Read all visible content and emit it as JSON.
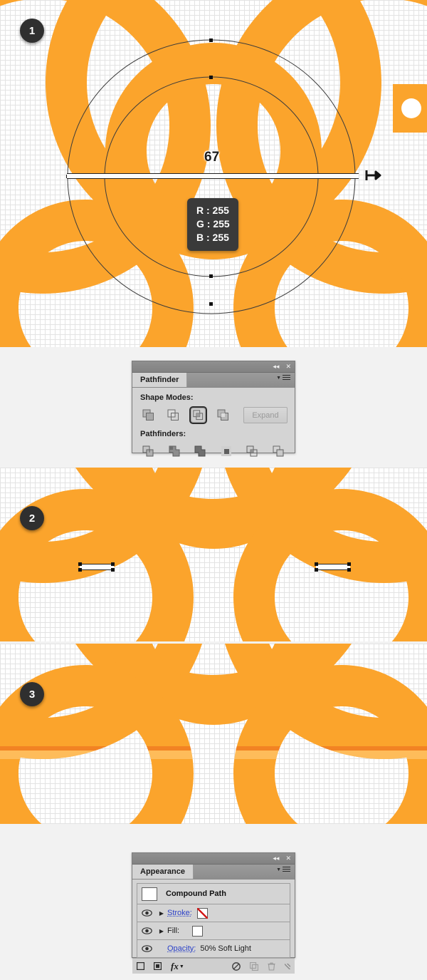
{
  "artwork": {
    "fill_color": "#fba42c",
    "highlight_color": "#f78e2a",
    "canvas_bg": "#ffffff",
    "grid_color": "#e3e3e3"
  },
  "steps": [
    {
      "number": "1",
      "name": "step-one"
    },
    {
      "number": "2",
      "name": "step-two"
    },
    {
      "number": "3",
      "name": "step-three"
    }
  ],
  "canvas1": {
    "measurement": "67",
    "rgb_tooltip": {
      "r": "R : 255",
      "g": "G : 255",
      "b": "B : 255"
    },
    "cursor": "horizontal-resize-cursor"
  },
  "pathfinder_panel": {
    "title": "Pathfinder",
    "titlebar": {
      "collapse_icon": "collapse-to-icons-icon",
      "collapse_glyph": "◂◂",
      "close_icon": "close-icon",
      "close_glyph": "✕"
    },
    "menu_icon": "panel-menu-icon",
    "shape_modes_label": "Shape Modes:",
    "shape_modes": [
      {
        "name": "unite-button",
        "label": "Unite",
        "selected": false
      },
      {
        "name": "minus-front-button",
        "label": "Minus Front",
        "selected": false
      },
      {
        "name": "intersect-button",
        "label": "Intersect",
        "selected": true
      },
      {
        "name": "exclude-button",
        "label": "Exclude",
        "selected": false
      }
    ],
    "expand_label": "Expand",
    "pathfinders_label": "Pathfinders:",
    "pathfinders": [
      {
        "name": "divide-button",
        "label": "Divide"
      },
      {
        "name": "trim-button",
        "label": "Trim"
      },
      {
        "name": "merge-button",
        "label": "Merge"
      },
      {
        "name": "crop-button",
        "label": "Crop"
      },
      {
        "name": "outline-button",
        "label": "Outline"
      },
      {
        "name": "minus-back-button",
        "label": "Minus Back"
      }
    ]
  },
  "appearance_panel": {
    "title": "Appearance",
    "titlebar": {
      "collapse_glyph": "◂◂",
      "close_glyph": "✕"
    },
    "object_label": "Compound Path",
    "rows": [
      {
        "name": "appearance-row-stroke",
        "label": "Stroke:",
        "link": true,
        "swatch": "none",
        "has_triangle": true,
        "value": ""
      },
      {
        "name": "appearance-row-fill",
        "label": "Fill:",
        "link": false,
        "swatch": "white",
        "has_triangle": true,
        "value": ""
      },
      {
        "name": "appearance-row-opacity",
        "label": "Opacity:",
        "link": true,
        "swatch": "",
        "has_triangle": false,
        "value": "50% Soft Light"
      }
    ],
    "footer": [
      {
        "name": "add-new-stroke-button",
        "icon": "square-outline-icon"
      },
      {
        "name": "add-new-fill-button",
        "icon": "filled-square-icon"
      },
      {
        "name": "add-effect-button",
        "icon": "fx-icon",
        "label": "fx"
      },
      {
        "name": "clear-appearance-button",
        "icon": "no-symbol-icon"
      },
      {
        "name": "duplicate-item-button",
        "icon": "duplicate-icon"
      },
      {
        "name": "delete-item-button",
        "icon": "trash-icon"
      }
    ],
    "resize_grip": "resize-grip-icon"
  }
}
